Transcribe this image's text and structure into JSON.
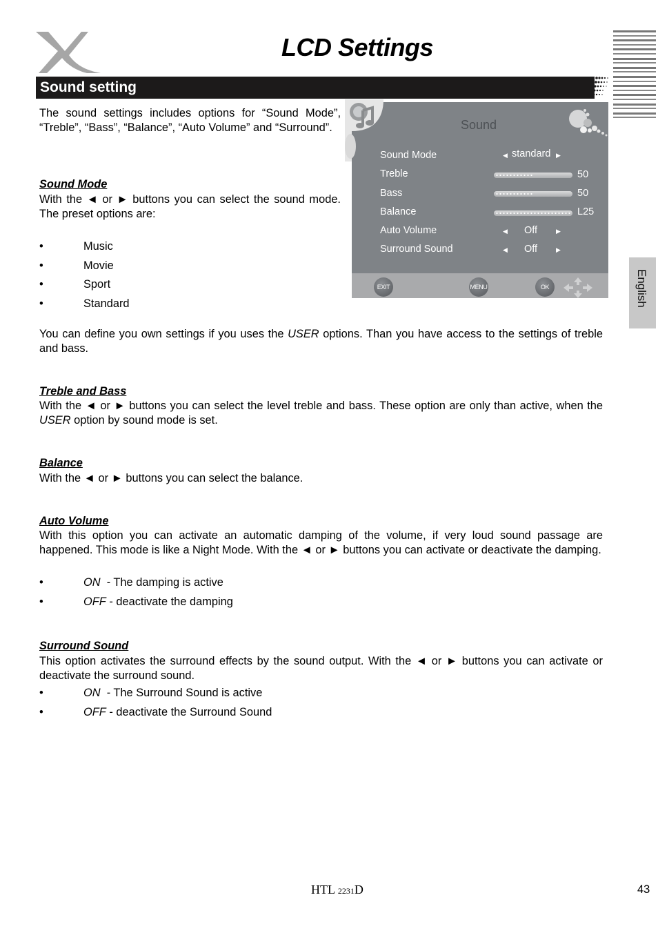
{
  "header": {
    "logo": "x-logo",
    "title": "LCD Settings",
    "section_title": "Sound setting",
    "language_tab": "English"
  },
  "intro": "The sound settings includes options for “Sound Mode”, “Treble”, “Bass”, “Balance”, “Auto Volume” and “Surround”.",
  "sound_mode": {
    "heading": "Sound Mode",
    "text": "With the ◄ or ► buttons you can select the sound mode. The preset options are:",
    "options": [
      "Music",
      "Movie",
      "Sport",
      "Standard"
    ],
    "user_text_1": "You can define you own settings if you uses the ",
    "user_em": "USER",
    "user_text_2": " options. Than you have access to the settings of treble and bass."
  },
  "treble_bass": {
    "heading": "Treble and Bass",
    "text_1": "With the ◄ or ► buttons you can select the level treble and bass. These option are only than active, when the ",
    "em": "USER",
    "text_2": " option by sound mode is set."
  },
  "balance": {
    "heading": "Balance",
    "text": "With the ◄ or ► buttons you can select the balance."
  },
  "auto_volume": {
    "heading": "Auto Volume",
    "text": "With this option you can activate an automatic damping of the volume, if very loud sound passage are happened. This mode is like a Night Mode. With the ◄ or ► buttons you can activate or deactivate the damping.",
    "bullets": [
      {
        "em": "ON",
        "text": "  - The damping is active"
      },
      {
        "em": "OFF",
        "text": " - deactivate the damping"
      }
    ]
  },
  "surround": {
    "heading": "Surround Sound",
    "text": "This option activates the surround effects by the sound output. With the ◄ or ► buttons you can activate or deactivate the surround sound.",
    "bullets": [
      {
        "em": "ON",
        "text": "  - The Surround Sound is active"
      },
      {
        "em": "OFF",
        "text": " - deactivate the Surround Sound"
      }
    ]
  },
  "osd": {
    "title": "Sound",
    "rows": [
      {
        "label": "Sound Mode",
        "value": "standard",
        "type": "select"
      },
      {
        "label": "Treble",
        "value": "50",
        "type": "slider",
        "level": 0.5
      },
      {
        "label": "Bass",
        "value": "50",
        "type": "slider",
        "level": 0.5
      },
      {
        "label": "Balance",
        "value": "L25",
        "type": "slider",
        "level": 1.0
      },
      {
        "label": "Auto Volume",
        "value": "Off",
        "type": "select"
      },
      {
        "label": "Surround Sound",
        "value": "Off",
        "type": "select"
      }
    ],
    "buttons": {
      "exit": "EXIT",
      "menu": "MENU",
      "ok": "OK"
    },
    "arrow_left": "◀",
    "arrow_right": "▶"
  },
  "footer": {
    "model_prefix": "HTL ",
    "model_number": "2231",
    "model_suffix": "D",
    "page_number": "43"
  },
  "colors": {
    "section_bar": "#1c1a1a",
    "osd_background": "#7f8387",
    "osd_footer": "#a9aaac",
    "language_tab": "#c8c8c8",
    "logo_gray": "#a6a6a6"
  },
  "bullet_char": "•"
}
